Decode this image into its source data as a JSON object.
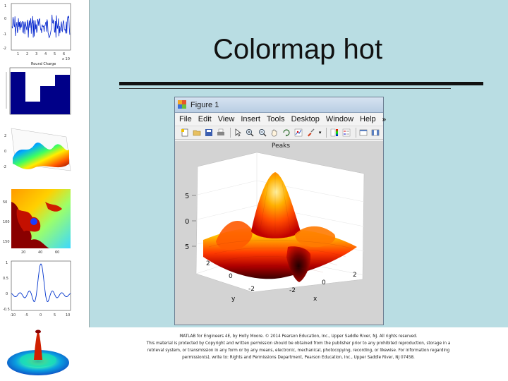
{
  "slide": {
    "title": "Colormap hot"
  },
  "figure_window": {
    "title": "Figure 1",
    "menu": [
      "File",
      "Edit",
      "View",
      "Insert",
      "Tools",
      "Desktop",
      "Window",
      "Help"
    ],
    "toolbar_icons": [
      "new-figure-icon",
      "open-file-icon",
      "save-icon",
      "print-icon",
      "select-arrow-icon",
      "zoom-in-icon",
      "zoom-out-icon",
      "pan-hand-icon",
      "rotate-3d-icon",
      "data-cursor-icon",
      "brush-icon",
      "colorbar-icon",
      "legend-icon",
      "hide-plot-tools-icon",
      "show-plot-tools-icon"
    ],
    "toolbar_overflow": "»",
    "colors": {
      "canvas": "#d3d3d3",
      "axes": "#ffffff",
      "titlebar": "#c6d6ea"
    }
  },
  "plot": {
    "title": "Peaks",
    "colormap": "hot",
    "z_ticks": [
      "5",
      "0",
      "5"
    ],
    "y_ticks": [
      "2",
      "0",
      "-2"
    ],
    "x_ticks": [
      "-2",
      "0",
      "2"
    ],
    "ylabel": "y",
    "xlabel": "x"
  },
  "thumbnails": {
    "t1": {
      "yticks": [
        "1",
        "0",
        "-1",
        "-2"
      ],
      "xticks": [
        "1",
        "2",
        "3",
        "4",
        "5",
        "6"
      ],
      "exp": "x 10",
      "title": "Round Charge"
    },
    "t3": {
      "yticks": [
        "2",
        "0",
        "-2"
      ]
    },
    "t4": {
      "yticks": [
        "50",
        "100",
        "150"
      ],
      "xticks": [
        "20",
        "40",
        "60"
      ]
    },
    "t5": {
      "yticks": [
        "1",
        "0.5",
        "0",
        "-0.5"
      ],
      "xticks": [
        "-10",
        "-5",
        "0",
        "5",
        "10"
      ]
    }
  },
  "footer": {
    "line1": "MATLAB for Engineers 4E, by Holly Moore. © 2014 Pearson Education, Inc., Upper Saddle River, NJ. All rights reserved.",
    "line2": "This material is protected by Copyright and written permission should be obtained from the publisher prior to any prohibited reproduction, storage in a",
    "line3": "retrieval system, or transmission in any form or by any means, electronic, mechanical, photocopying, recording, or likewise. For information regarding",
    "line4": "permission(s), write to: Rights and Permissions Department, Pearson Education, Inc., Upper Saddle River, NJ 07458."
  }
}
